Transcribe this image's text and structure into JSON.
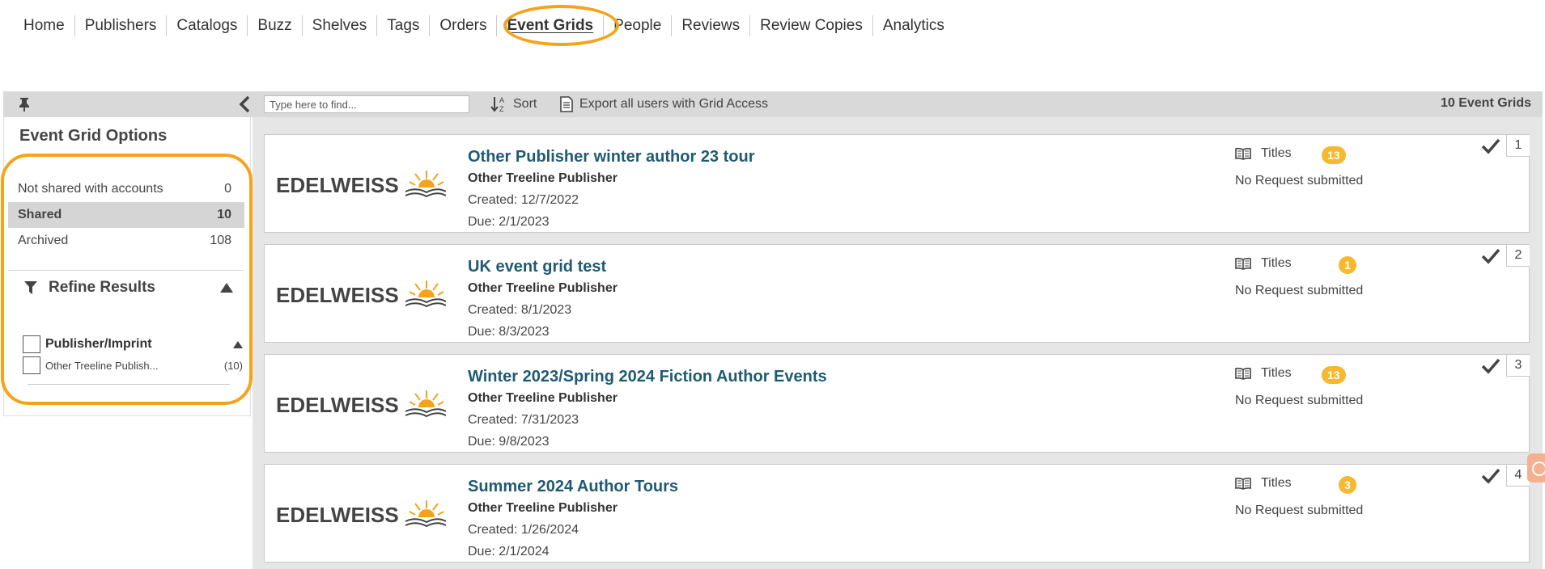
{
  "nav": {
    "items": [
      "Home",
      "Publishers",
      "Catalogs",
      "Buzz",
      "Shelves",
      "Tags",
      "Orders",
      "Event Grids",
      "People",
      "Reviews",
      "Review Copies",
      "Analytics"
    ]
  },
  "toolbar": {
    "search_placeholder": "Type here to find...",
    "sort_label": "Sort",
    "export_label": "Export all users with Grid Access",
    "count_label": "10 Event Grids"
  },
  "sidebar": {
    "title": "Event Grid Options",
    "options": [
      {
        "label": "Not shared with accounts",
        "count": "0"
      },
      {
        "label": "Shared",
        "count": "10"
      },
      {
        "label": "Archived",
        "count": "108"
      }
    ],
    "refine_label": "Refine Results",
    "facet_title": "Publisher/Imprint",
    "facet_item": "Other Treeline Publish...",
    "facet_item_count": "(10)"
  },
  "logo": {
    "brand": "EDELWEISS"
  },
  "cards": [
    {
      "title": "Other Publisher winter author 23 tour",
      "publisher": "Other Treeline Publisher",
      "created": "Created: 12/7/2022",
      "due": "Due: 2/1/2023",
      "titles_label": "Titles",
      "titles_count": "13",
      "request": "No Request submitted",
      "index": "1"
    },
    {
      "title": "UK event grid test",
      "publisher": "Other Treeline Publisher",
      "created": "Created: 8/1/2023",
      "due": "Due: 8/3/2023",
      "titles_label": "Titles",
      "titles_count": "1",
      "request": "No Request submitted",
      "index": "2"
    },
    {
      "title": "Winter 2023/Spring 2024 Fiction Author Events",
      "publisher": "Other Treeline Publisher",
      "created": "Created: 7/31/2023",
      "due": "Due: 9/8/2023",
      "titles_label": "Titles",
      "titles_count": "13",
      "request": "No Request submitted",
      "index": "3"
    },
    {
      "title": "Summer 2024 Author Tours",
      "publisher": "Other Treeline Publisher",
      "created": "Created: 1/26/2024",
      "due": "Due: 2/1/2024",
      "titles_label": "Titles",
      "titles_count": "3",
      "request": "No Request submitted",
      "index": "4"
    }
  ],
  "colors": {
    "accent": "#f5a31a",
    "link": "#1f5a73",
    "badge": "#f5b82e"
  }
}
